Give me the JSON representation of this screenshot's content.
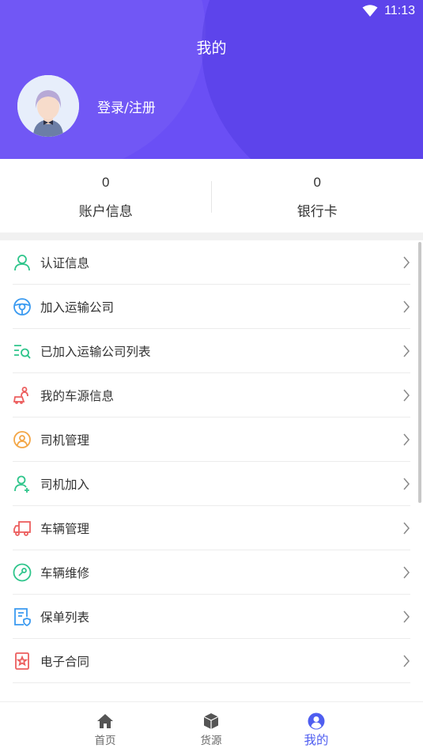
{
  "status_bar": {
    "time": "11:13"
  },
  "header": {
    "title": "我的",
    "login_label": "登录/注册"
  },
  "stats": [
    {
      "value": "0",
      "label": "账户信息"
    },
    {
      "value": "0",
      "label": "银行卡"
    }
  ],
  "menu": [
    {
      "label": "认证信息",
      "icon": "user-verify-icon"
    },
    {
      "label": "加入运输公司",
      "icon": "steering-wheel-icon"
    },
    {
      "label": "已加入运输公司列表",
      "icon": "list-search-icon"
    },
    {
      "label": "我的车源信息",
      "icon": "car-source-icon"
    },
    {
      "label": "司机管理",
      "icon": "driver-wheel-icon"
    },
    {
      "label": "司机加入",
      "icon": "driver-join-icon"
    },
    {
      "label": "车辆管理",
      "icon": "truck-icon"
    },
    {
      "label": "车辆维修",
      "icon": "wrench-icon"
    },
    {
      "label": "保单列表",
      "icon": "policy-list-icon"
    },
    {
      "label": "电子合同",
      "icon": "contract-icon"
    }
  ],
  "bottom_nav": [
    {
      "label": "首页",
      "icon": "home-icon"
    },
    {
      "label": "货源",
      "icon": "cargo-box-icon"
    },
    {
      "label": "我的",
      "icon": "profile-icon",
      "active": true
    }
  ],
  "colors": {
    "header_bg": "#6a4ff5",
    "accent": "#4f5ef0",
    "green": "#2ec58b",
    "blue": "#3a9af0",
    "orange": "#f3a646",
    "red": "#ec5e5e"
  }
}
